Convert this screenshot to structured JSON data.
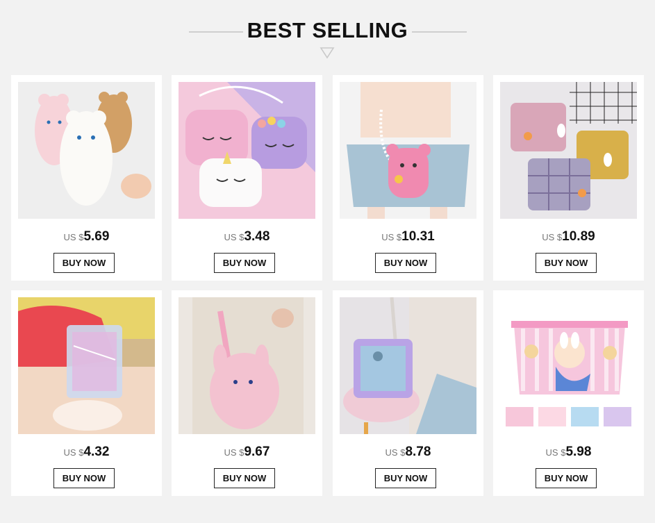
{
  "section": {
    "title": "BEST SELLING",
    "icon": "down-triangle-icon"
  },
  "products": [
    {
      "currency": "US $",
      "price": "5.69",
      "button": "BUY NOW",
      "image": "fluffy-cat-plush-bags"
    },
    {
      "currency": "US $",
      "price": "3.48",
      "button": "BUY NOW",
      "image": "unicorn-plush-crossbody-bags"
    },
    {
      "currency": "US $",
      "price": "10.31",
      "button": "BUY NOW",
      "image": "pink-bear-pearl-strap-bag"
    },
    {
      "currency": "US $",
      "price": "10.89",
      "button": "BUY NOW",
      "image": "plaid-bunny-shoulder-bags"
    },
    {
      "currency": "US $",
      "price": "4.32",
      "button": "BUY NOW",
      "image": "holographic-transparent-bag"
    },
    {
      "currency": "US $",
      "price": "9.67",
      "button": "BUY NOW",
      "image": "pink-plush-bunny-backpack"
    },
    {
      "currency": "US $",
      "price": "8.78",
      "button": "BUY NOW",
      "image": "holographic-plush-bear-bag"
    },
    {
      "currency": "US $",
      "price": "5.98",
      "button": "BUY NOW",
      "image": "cartoon-storage-box-set"
    }
  ]
}
